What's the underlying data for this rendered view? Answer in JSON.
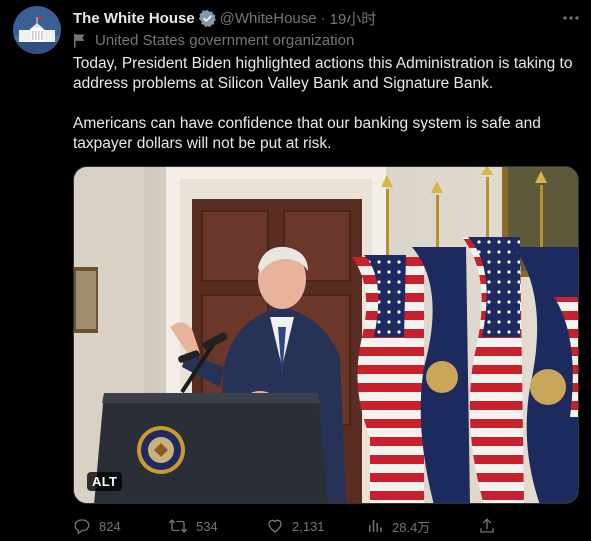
{
  "author": {
    "display_name": "The White House",
    "handle": "@WhiteHouse",
    "timestamp": "19小时",
    "verified_badge_color": "#829aab",
    "affiliation": "United States government organization"
  },
  "tweet": {
    "paragraphs": [
      "Today, President Biden highlighted actions this Administration is taking to address problems at Silicon Valley Bank and Signature Bank.",
      "Americans can have confidence that our banking system is safe and taxpayer dollars will not be put at risk."
    ]
  },
  "media": {
    "alt_label": "ALT"
  },
  "actions": {
    "replies": "824",
    "retweets": "534",
    "likes": "2,131",
    "views": "28.4万"
  },
  "icons": {
    "more": "more-icon",
    "reply": "reply-icon",
    "retweet": "retweet-icon",
    "like": "like-icon",
    "views": "views-icon",
    "share": "share-icon",
    "flag": "flag-icon",
    "verified": "verified-badge-icon"
  },
  "colors": {
    "background": "#000000",
    "text": "#e7e9ea",
    "secondary": "#71767b"
  }
}
